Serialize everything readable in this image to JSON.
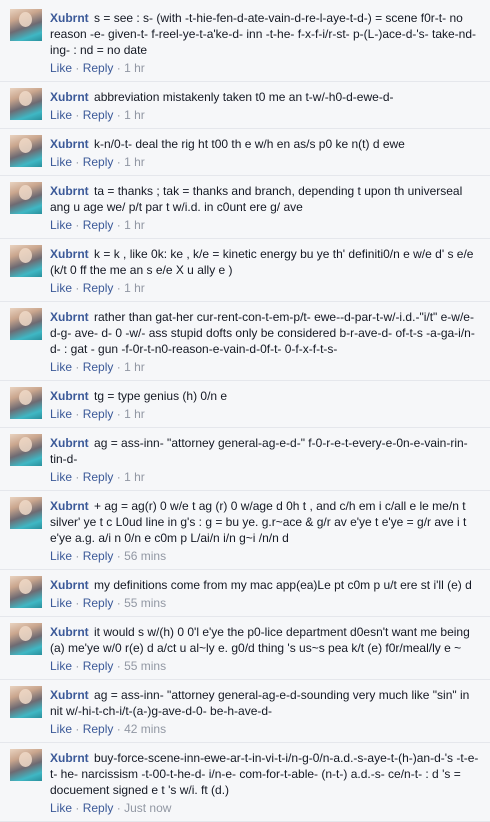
{
  "labels": {
    "like": "Like",
    "reply": "Reply",
    "separator": "·"
  },
  "comments": [
    {
      "author": "Xubrnt",
      "text": "s = see : s- (with -t-hie-fen-d-ate-vain-d-re-l-aye-t-d-) = scene f0r-t- no reason -e- given-t- f-reel-ye-t-a'ke-d- inn -t-he- f-x-f-i/r-st- p-(L-)ace-d-'s- take-nd-ing- : nd = no date",
      "time": "1 hr"
    },
    {
      "author": "Xubrnt",
      "text": "abbreviation mistakenly taken t0 me an t-w/-h0-d-ewe-d-",
      "time": "1 hr"
    },
    {
      "author": "Xubrnt",
      "text": "k-n/0-t- deal the rig ht t00 th e w/h en as/s p0 ke n(t) d ewe",
      "time": "1 hr"
    },
    {
      "author": "Xubrnt",
      "text": "ta = thanks ; tak = thanks and branch, depending t upon th universeal ang u age we/ p/t par t w/i.d. in c0unt ere g/ ave",
      "time": "1 hr"
    },
    {
      "author": "Xubrnt",
      "text": "k = k , like 0k: ke , k/e = kinetic energy bu ye th' definiti0/n e w/e d' s e/e (k/t 0 ff the me an s e/e X u ally e )",
      "time": "1 hr"
    },
    {
      "author": "Xubrnt",
      "text": "rather than gat-her cur-rent-con-t-em-p/t- ewe--d-par-t-w/-i.d.-\"i/t\" e-w/e-d-g- ave- d- 0 -w/- ass stupid dofts only be considered b-r-ave-d- of-t-s -a-ga-i/n-d- : gat - gun -f-0r-t-n0-reason-e-vain-d-0f-t- 0-f-x-f-t-s-",
      "time": "1 hr"
    },
    {
      "author": "Xubrnt",
      "text": "tg = type genius (h) 0/n e",
      "time": "1 hr"
    },
    {
      "author": "Xubrnt",
      "text": "ag = ass-inn- \"attorney general-ag-e-d-\" f-0-r-e-t-every-e-0n-e-vain-rin-tin-d-",
      "time": "1 hr"
    },
    {
      "author": "Xubrnt",
      "text": "+ ag = ag(r) 0 w/e t ag (r) 0 w/age d 0h t , and c/h em i c/all e le me/n t silver' ye t c L0ud line in g's : g = bu ye. g.r~ace & g/r av e'ye t e'ye = g/r ave i t e'ye a.g. a/i n 0/n e c0m p L/ai/n i/n g~i /n/n d",
      "time": "56 mins"
    },
    {
      "author": "Xubrnt",
      "text": "my definitions come from my mac app(ea)Le pt c0m p u/t ere st i'll (e) d",
      "time": "55 mins"
    },
    {
      "author": "Xubrnt",
      "text": "it would s w/(h) 0 0'l e'ye the p0-lice department d0esn't want me being (a) me'ye w/0 r(e) d a/ct u al~ly e. g0/d thing 's us~s pea k/t (e) f0r/meal/ly e ~",
      "time": "55 mins"
    },
    {
      "author": "Xubrnt",
      "text": "ag = ass-inn- \"attorney general-ag-e-d-sounding very much like \"sin\" in nit w/-hi-t-ch-i/t-(a-)g-ave-d-0- be-h-ave-d-",
      "time": "42 mins"
    },
    {
      "author": "Xubrnt",
      "text": "buy-force-scene-inn-ewe-ar-t-in-vi-t-i/n-g-0/n-a.d.-s-aye-t-(h-)an-d-'s -t-e-t- he- narcissism -t-00-t-he-d- i/n-e- com-for-t-able- (n-t-) a.d.-s- ce/n-t- : d 's = docuement signed e t 's w/i. ft (d.)",
      "time": "Just now"
    }
  ]
}
